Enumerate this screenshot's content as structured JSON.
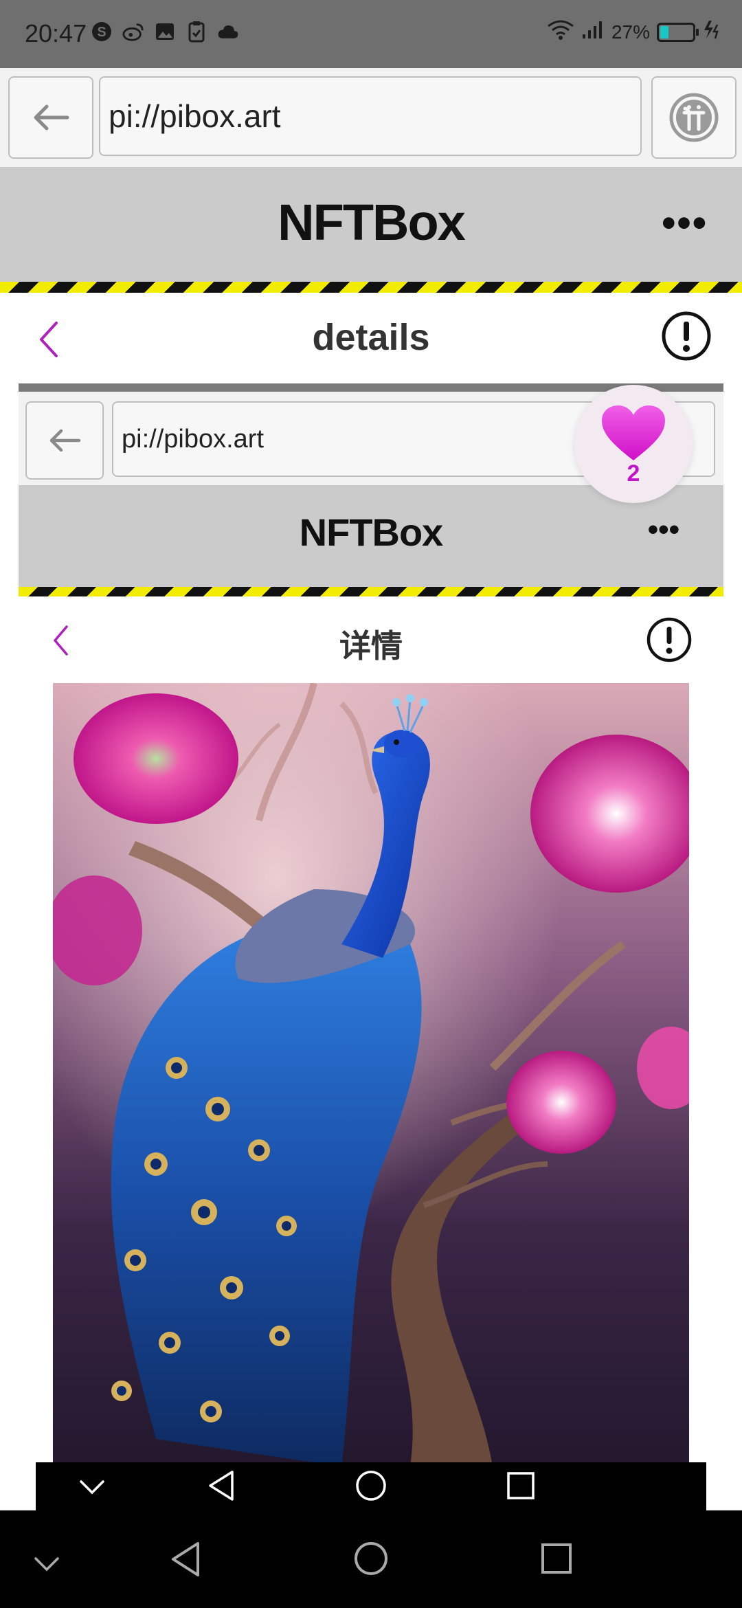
{
  "status_bar": {
    "time": "20:47",
    "battery_percent": "27%",
    "battery_level": 0.27,
    "left_icons": [
      "s-circle-icon",
      "weibo-icon",
      "image-icon",
      "clipboard-icon",
      "cloud-icon"
    ],
    "right_icons": [
      "wifi-icon",
      "signal-icon",
      "battery-icon",
      "charging-icon"
    ]
  },
  "browser_bar": {
    "url": "pi://pibox.art",
    "back_icon": "arrow-left-icon",
    "pi_icon": "pi-network-icon"
  },
  "app_header": {
    "title": "NFTBox",
    "menu_label": "•••"
  },
  "detail_header": {
    "title": "details"
  },
  "inner_screenshot": {
    "url": "pi://pibox.art",
    "app_title": "NFTBox",
    "menu_label": "•••",
    "detail_title": "详情"
  },
  "like_badge": {
    "count": "2",
    "icon": "heart-icon",
    "color": "#e61ad0"
  },
  "artwork": {
    "subject": "peacock-on-blossom-branch"
  },
  "colors": {
    "accent_purple": "#b01fc0",
    "header_gray": "#cbcbcb",
    "hazard_yellow": "#f2ec00"
  }
}
